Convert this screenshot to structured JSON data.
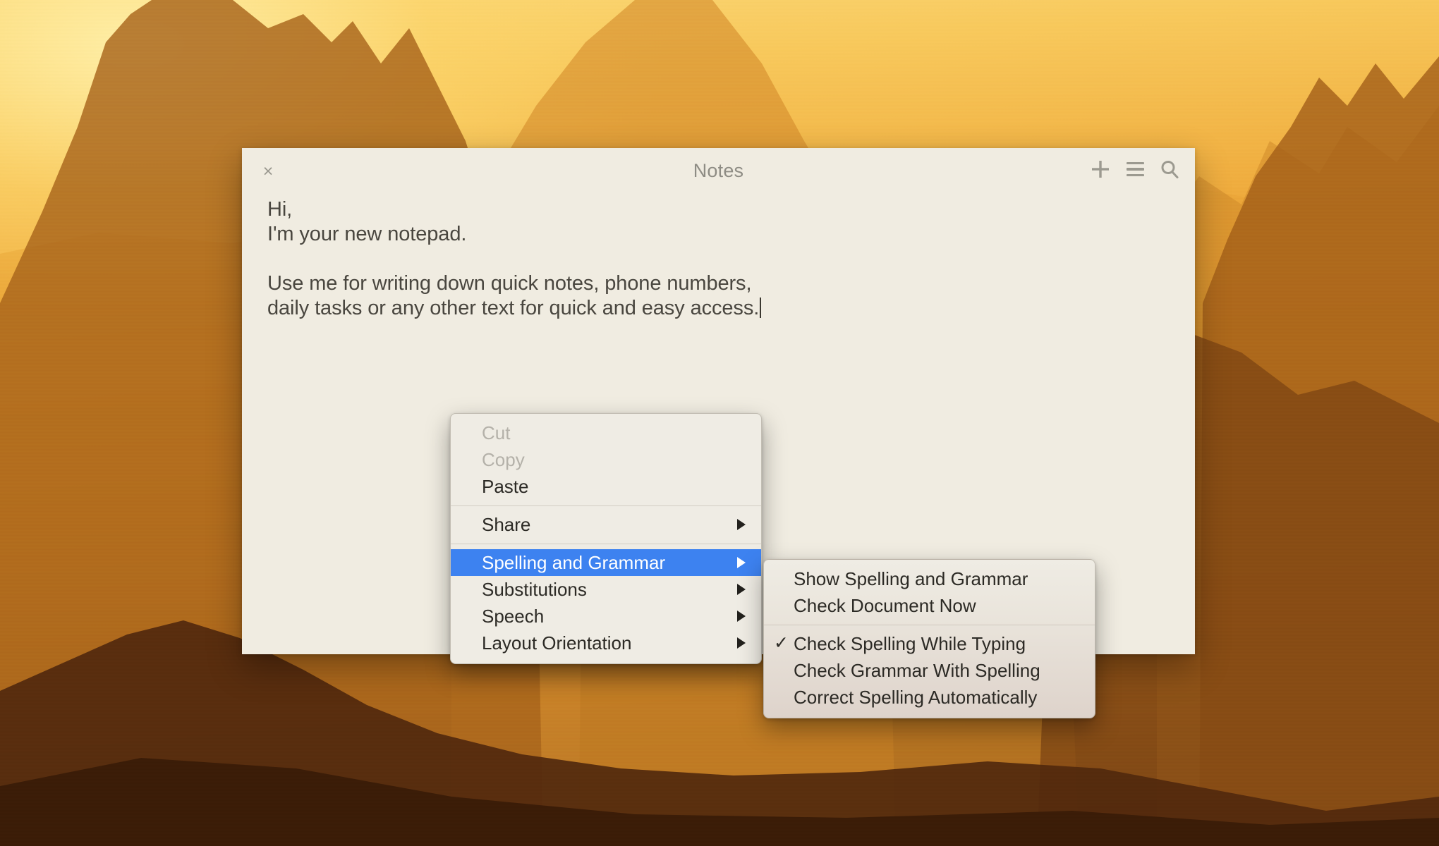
{
  "desktop": {
    "wallpaper_name": "sunset-mountains-wallpaper",
    "colors": {
      "sky_top": "#fbd97a",
      "sky_mid": "#f0ad3f",
      "mountain_far": "#e09a2e",
      "mountain_mid": "#c87c22",
      "mountain_near": "#8d5016",
      "foreground": "#4a240c"
    }
  },
  "notes_window": {
    "title": "Notes",
    "close_label": "×",
    "actions": [
      {
        "name": "new-note",
        "label": "+"
      },
      {
        "name": "menu-list",
        "label": "☰"
      },
      {
        "name": "search",
        "label": "⌕"
      }
    ],
    "note_text": "Hi,\nI'm your new notepad.\n\nUse me for writing down quick notes, phone numbers,\ndaily tasks or any other text for quick and easy access.",
    "caret_visible": true
  },
  "context_menu": {
    "accent_color": "#3d82f0",
    "items": [
      {
        "label": "Cut",
        "state": "disabled",
        "submenu": false
      },
      {
        "label": "Copy",
        "state": "disabled",
        "submenu": false
      },
      {
        "label": "Paste",
        "state": "enabled",
        "submenu": false
      },
      {
        "separator": true
      },
      {
        "label": "Share",
        "state": "enabled",
        "submenu": true
      },
      {
        "separator": true
      },
      {
        "label": "Spelling and Grammar",
        "state": "selected",
        "submenu": true
      },
      {
        "label": "Substitutions",
        "state": "enabled",
        "submenu": true
      },
      {
        "label": "Speech",
        "state": "enabled",
        "submenu": true
      },
      {
        "label": "Layout Orientation",
        "state": "enabled",
        "submenu": true
      }
    ]
  },
  "submenu": {
    "parent": "Spelling and Grammar",
    "items": [
      {
        "label": "Show Spelling and Grammar",
        "checked": false
      },
      {
        "label": "Check Document Now",
        "checked": false
      },
      {
        "separator": true
      },
      {
        "label": "Check Spelling While Typing",
        "checked": true
      },
      {
        "label": "Check Grammar With Spelling",
        "checked": false
      },
      {
        "label": "Correct Spelling Automatically",
        "checked": false
      }
    ],
    "check_glyph": "✓"
  }
}
